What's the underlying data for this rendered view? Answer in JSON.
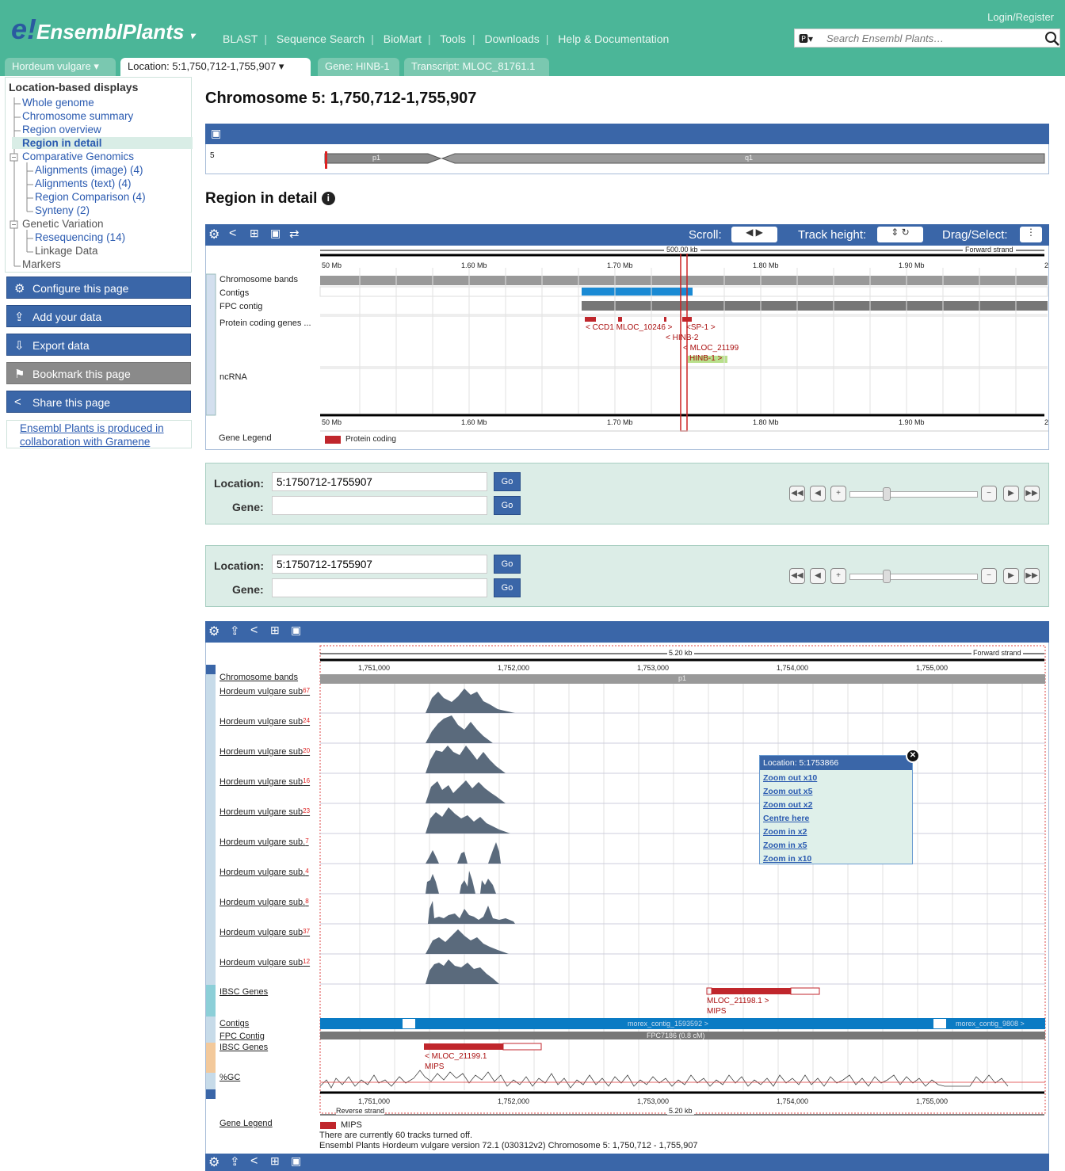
{
  "header": {
    "logo_text": "EnsemblPlants",
    "logo_mark": "e!",
    "login": "Login/Register",
    "search_placeholder": "Search Ensembl Plants…",
    "nav": [
      "BLAST",
      "Sequence Search",
      "BioMart",
      "Tools",
      "Downloads",
      "Help & Documentation"
    ]
  },
  "tabs": [
    "Hordeum vulgare",
    "Location: 5:1,750,712-1,755,907",
    "Gene: HINB-1",
    "Transcript: MLOC_81761.1"
  ],
  "sidebar": {
    "heading": "Location-based displays",
    "items": [
      "Whole genome",
      "Chromosome summary",
      "Region overview",
      "Region in detail",
      "Comparative Genomics",
      "Alignments (image) (4)",
      "Alignments (text) (4)",
      "Region Comparison (4)",
      "Synteny (2)",
      "Genetic Variation",
      "Resequencing (14)",
      "Linkage Data",
      "Markers"
    ],
    "buttons": [
      "Configure this page",
      "Add your data",
      "Export data",
      "Bookmark this page",
      "Share this page"
    ],
    "credit": "Ensembl Plants is produced in collaboration with Gramene"
  },
  "page": {
    "title": "Chromosome 5: 1,750,712-1,755,907",
    "region_heading": "Region in detail"
  },
  "chrom": {
    "name": "5",
    "p": "p1",
    "q": "q1"
  },
  "overview": {
    "scroll": "Scroll:",
    "track_height": "Track height:",
    "drag": "Drag/Select:",
    "span": "500.00 kb",
    "strand": "Forward strand",
    "ticks": [
      "50 Mb",
      "1.60 Mb",
      "1.70 Mb",
      "1.80 Mb",
      "1.90 Mb",
      "2"
    ],
    "tracks": [
      "Chromosome bands",
      "Contigs",
      "FPC contig",
      "Protein coding genes ...",
      "ncRNA"
    ],
    "genes": [
      "< CCD1 MLOC_10246 >",
      "<SP-1 >",
      "< HINB-2",
      "< MLOC_21199",
      "HINB-1 >"
    ],
    "legend_title": "Gene Legend",
    "legend_item": "Protein coding"
  },
  "locform": {
    "loc_label": "Location:",
    "gene_label": "Gene:",
    "loc_value": "5:1750712-1755907",
    "go": "Go"
  },
  "detail": {
    "span": "5.20 kb",
    "strand": "Forward strand",
    "rev_strand": "Reverse strand",
    "ticks": [
      "1,751,000",
      "1,752,000",
      "1,753,000",
      "1,754,000",
      "1,755,000"
    ],
    "band": "p1",
    "tracks": [
      {
        "label": "Chromosome bands",
        "n": ""
      },
      {
        "label": "Hordeum vulgare sub",
        "n": "67"
      },
      {
        "label": "Hordeum vulgare sub",
        "n": "24"
      },
      {
        "label": "Hordeum vulgare sub",
        "n": "20"
      },
      {
        "label": "Hordeum vulgare sub",
        "n": "16"
      },
      {
        "label": "Hordeum vulgare sub",
        "n": "23"
      },
      {
        "label": "Hordeum vulgare sub.",
        "n": "7"
      },
      {
        "label": "Hordeum vulgare sub.",
        "n": "4"
      },
      {
        "label": "Hordeum vulgare sub.",
        "n": "8"
      },
      {
        "label": "Hordeum vulgare sub",
        "n": "37"
      },
      {
        "label": "Hordeum vulgare sub",
        "n": "12"
      },
      {
        "label": "IBSC Genes",
        "n": ""
      },
      {
        "label": "Contigs",
        "n": ""
      },
      {
        "label": "FPC Contig",
        "n": ""
      },
      {
        "label": "IBSC Genes",
        "n": ""
      },
      {
        "label": "%GC",
        "n": ""
      }
    ],
    "gene_fwd": "MLOC_21198.1 >",
    "gene_rev": "< MLOC_21199.1",
    "mips": "MIPS",
    "contig1": "morex_contig_1593592 >",
    "contig2": "morex_contig_9808 >",
    "fpc": "FPC7186 (0.8 cM)",
    "legend_title": "Gene Legend",
    "legend_item": "MIPS",
    "note1": "There are currently 60 tracks turned off.",
    "note2": "Ensembl Plants Hordeum vulgare version 72.1 (030312v2) Chromosome 5: 1,750,712 - 1,755,907"
  },
  "popup": {
    "title": "Location: 5:1753866",
    "items": [
      "Zoom out x10",
      "Zoom out x5",
      "Zoom out x2",
      "Centre here",
      "Zoom in x2",
      "Zoom in x5",
      "Zoom in x10"
    ]
  },
  "colors": {
    "teal": "#4bb698",
    "blue": "#3a66a8",
    "gene_red": "#c0262c",
    "contig_blue": "#0a7bc4"
  }
}
